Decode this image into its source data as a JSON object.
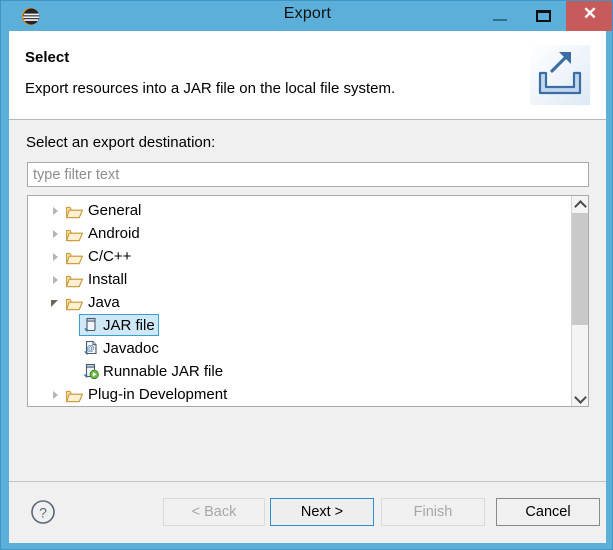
{
  "window": {
    "title": "Export",
    "app_icon": "eclipse-icon",
    "frame_color": "#5cafd9",
    "controls": {
      "minimize": "—",
      "maximize": "□",
      "close": "✕",
      "close_color": "#c75b5b"
    }
  },
  "header": {
    "title": "Select",
    "description": "Export resources into a JAR file on the local file system.",
    "icon": "export-wizard-icon"
  },
  "main": {
    "destination_label": "Select an export destination:",
    "filter": {
      "value": "",
      "placeholder": "type filter text"
    },
    "tree": [
      {
        "label": "General",
        "level": 0,
        "expanded": false,
        "icon": "folder-icon",
        "selected": false
      },
      {
        "label": "Android",
        "level": 0,
        "expanded": false,
        "icon": "folder-icon",
        "selected": false
      },
      {
        "label": "C/C++",
        "level": 0,
        "expanded": false,
        "icon": "folder-icon",
        "selected": false
      },
      {
        "label": "Install",
        "level": 0,
        "expanded": false,
        "icon": "folder-icon",
        "selected": false
      },
      {
        "label": "Java",
        "level": 0,
        "expanded": true,
        "icon": "folder-icon",
        "selected": false
      },
      {
        "label": "JAR file",
        "level": 1,
        "expanded": null,
        "icon": "jar-file-icon",
        "selected": true
      },
      {
        "label": "Javadoc",
        "level": 1,
        "expanded": null,
        "icon": "javadoc-icon",
        "selected": false
      },
      {
        "label": "Runnable JAR file",
        "level": 1,
        "expanded": null,
        "icon": "runnable-jar-icon",
        "selected": false
      },
      {
        "label": "Plug-in Development",
        "level": 0,
        "expanded": false,
        "icon": "folder-icon",
        "selected": false
      }
    ],
    "scrollbar": {
      "up_arrow": "chevron-up-icon",
      "down_arrow": "chevron-down-icon"
    }
  },
  "footer": {
    "help": "?",
    "buttons": {
      "back": {
        "label": "< Back",
        "enabled": false
      },
      "next": {
        "label": "Next >",
        "enabled": true,
        "focused": true
      },
      "finish": {
        "label": "Finish",
        "enabled": false
      },
      "cancel": {
        "label": "Cancel",
        "enabled": true
      }
    },
    "focus_color": "#2b8fd4"
  }
}
